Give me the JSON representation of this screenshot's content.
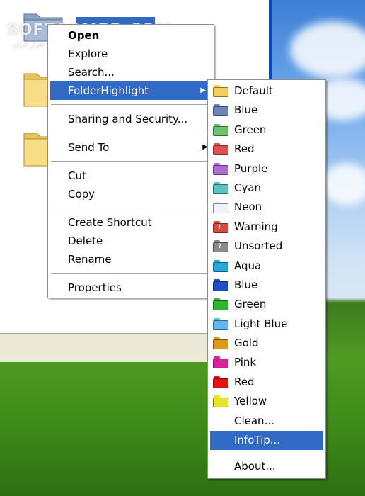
{
  "watermark": {
    "text": "SOFTCOMPR.COM",
    "subtitle": "اولین دانلودکننده نرم افزار ایران"
  },
  "context_menu": {
    "items": [
      {
        "label": "Open",
        "bold": true
      },
      {
        "label": "Explore"
      },
      {
        "label": "Search..."
      },
      {
        "label": "FolderHighlight",
        "highlighted": true,
        "submenu": true
      },
      {
        "separator": true
      },
      {
        "label": "Sharing and Security..."
      },
      {
        "separator": true
      },
      {
        "label": "Send To",
        "submenu": true
      },
      {
        "separator": true
      },
      {
        "label": "Cut"
      },
      {
        "label": "Copy"
      },
      {
        "separator": true
      },
      {
        "label": "Create Shortcut"
      },
      {
        "label": "Delete"
      },
      {
        "label": "Rename"
      },
      {
        "separator": true
      },
      {
        "label": "Properties"
      }
    ]
  },
  "submenu": {
    "items": [
      {
        "label": "Default",
        "icon": "folder-default-icon",
        "color": "#f2cf5a"
      },
      {
        "label": "Blue",
        "icon": "folder-blue-icon",
        "color": "#6b86b8"
      },
      {
        "label": "Green",
        "icon": "folder-green-icon",
        "color": "#6ec26e"
      },
      {
        "label": "Red",
        "icon": "folder-red-icon",
        "color": "#e25151"
      },
      {
        "label": "Purple",
        "icon": "folder-purple-icon",
        "color": "#b06ad0"
      },
      {
        "label": "Cyan",
        "icon": "folder-cyan-icon",
        "color": "#5cc3c3"
      },
      {
        "label": "Neon",
        "icon": "folder-neon-icon",
        "color": "#eef4ff"
      },
      {
        "label": "Warning",
        "icon": "folder-warning-icon",
        "color": "#d94a3e",
        "mark": "!"
      },
      {
        "label": "Unsorted",
        "icon": "folder-unsorted-icon",
        "color": "#8a8a8a",
        "mark": "?"
      },
      {
        "label": "Aqua",
        "icon": "folder-aqua-icon",
        "color": "#2aa7d8"
      },
      {
        "label": "Blue",
        "icon": "folder-darkblue-icon",
        "color": "#1b4fc2"
      },
      {
        "label": "Green",
        "icon": "folder-brightgreen-icon",
        "color": "#2db32d"
      },
      {
        "label": "Light Blue",
        "icon": "folder-lightblue-icon",
        "color": "#63b6ee"
      },
      {
        "label": "Gold",
        "icon": "folder-gold-icon",
        "color": "#d99a1c"
      },
      {
        "label": "Pink",
        "icon": "folder-pink-icon",
        "color": "#d1249a"
      },
      {
        "label": "Red",
        "icon": "folder-brightred-icon",
        "color": "#e01414"
      },
      {
        "label": "Yellow",
        "icon": "folder-yellow-icon",
        "color": "#e8e22a"
      },
      {
        "label": "Clean..."
      },
      {
        "label": "InfoTip...",
        "highlighted": true
      },
      {
        "separator": true
      },
      {
        "label": "About..."
      }
    ]
  },
  "colors": {
    "highlight": "#316ac5",
    "window_border": "#0a46c8"
  }
}
